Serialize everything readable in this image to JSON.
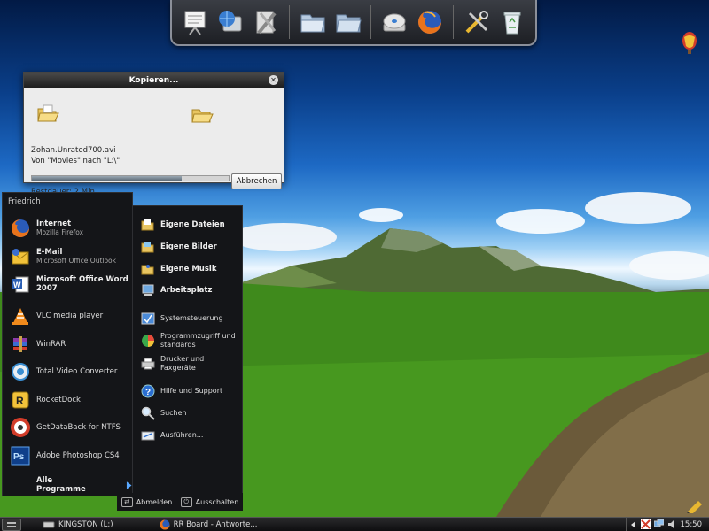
{
  "dialog": {
    "title": "Kopieren...",
    "close_symbol": "✕",
    "file_name": "Zohan.Unrated700.avi",
    "route": "Von \"Movies\" nach \"L:\\\"",
    "progress_percent": 76,
    "cancel_label": "Abbrechen",
    "time_remaining": "Restdauer: 2 Min."
  },
  "dock": {
    "icons": [
      "presentation-icon",
      "network-computer-icon",
      "tools-icon",
      "folder-open-icon",
      "folder-icon",
      "disc-drive-icon",
      "firefox-icon",
      "settings-tools-icon",
      "recycle-bin-icon"
    ]
  },
  "start_menu": {
    "user_name": "Friedrich",
    "pinned": [
      {
        "title": "Internet",
        "subtitle": "Mozilla Firefox",
        "icon": "firefox-icon"
      },
      {
        "title": "E-Mail",
        "subtitle": "Microsoft Office Outlook",
        "icon": "outlook-icon"
      },
      {
        "title": "Microsoft Office Word",
        "subtitle": "2007",
        "icon": "word-icon"
      }
    ],
    "recent": [
      {
        "label": "VLC media player",
        "icon": "vlc-icon"
      },
      {
        "label": "WinRAR",
        "icon": "winrar-icon"
      },
      {
        "label": "Total Video Converter",
        "icon": "video-converter-icon"
      },
      {
        "label": "RocketDock",
        "icon": "rocketdock-icon"
      },
      {
        "label": "GetDataBack for NTFS",
        "icon": "getdataback-icon"
      },
      {
        "label": "Adobe Photoshop CS4",
        "icon": "photoshop-icon"
      }
    ],
    "all_programs": "Alle Programme",
    "right_items": [
      {
        "label": "Eigene Dateien",
        "bold": true,
        "icon": "documents-folder-icon"
      },
      {
        "label": "Eigene Bilder",
        "bold": true,
        "icon": "pictures-folder-icon"
      },
      {
        "label": "Eigene Musik",
        "bold": true,
        "icon": "music-folder-icon"
      },
      {
        "label": "Arbeitsplatz",
        "bold": true,
        "icon": "my-computer-icon"
      },
      {
        "label": "Systemsteuerung",
        "bold": false,
        "icon": "control-panel-icon"
      },
      {
        "label": "Programmzugriff und standards",
        "bold": false,
        "icon": "program-access-icon"
      },
      {
        "label": "Drucker und Faxgeräte",
        "bold": false,
        "icon": "printer-icon"
      },
      {
        "label": "Hilfe und Support",
        "bold": false,
        "icon": "help-icon"
      },
      {
        "label": "Suchen",
        "bold": false,
        "icon": "search-icon"
      },
      {
        "label": "Ausführen...",
        "bold": false,
        "icon": "run-icon"
      }
    ],
    "logoff_label": "Abmelden",
    "shutdown_label": "Ausschalten"
  },
  "taskbar": {
    "tasks": [
      {
        "label": "KINGSTON (L:)",
        "icon": "drive-icon"
      },
      {
        "label": "RR Board - Antworte...",
        "icon": "firefox-icon"
      }
    ],
    "clock": "15:50"
  },
  "colors": {
    "menu_bg": "#141518",
    "dialog_bg": "#ececec",
    "taskbar_bg": "#1a1a1c"
  }
}
